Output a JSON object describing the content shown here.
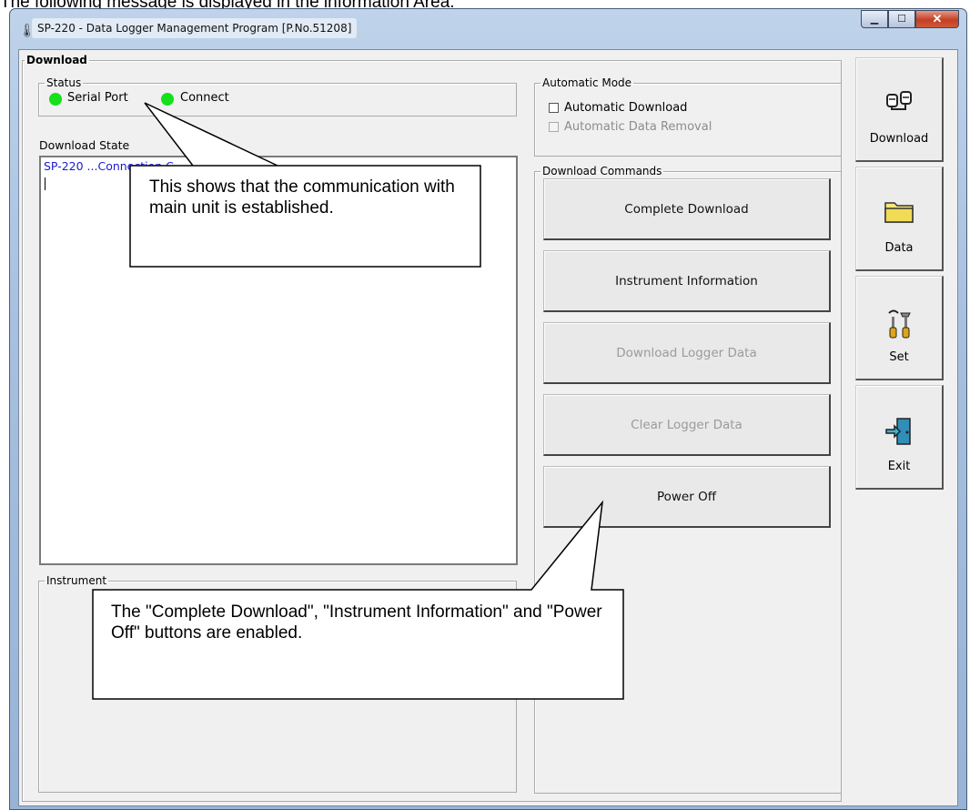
{
  "caption": "The following message is displayed in the information Area.",
  "window": {
    "title": "SP-220  - Data Logger Management Program [P.No.51208]"
  },
  "download_panel": {
    "title": "Download",
    "status": {
      "title": "Status",
      "serial_port": "Serial Port",
      "connect": "Connect",
      "led_color": "#15e01a"
    },
    "download_state_label": "Download State",
    "log_text": "SP-220 ...Connection C",
    "instrument_title": "Instrument"
  },
  "automatic_mode": {
    "title": "Automatic Mode",
    "automatic_download": "Automatic Download",
    "automatic_data_removal": "Automatic Data Removal"
  },
  "download_commands": {
    "title": "Download Commands",
    "complete_download": "Complete Download",
    "instrument_information": "Instrument Information",
    "download_logger_data": "Download Logger Data",
    "clear_logger_data": "Clear Logger Data",
    "power_off": "Power Off"
  },
  "sidebar": {
    "download": "Download",
    "data": "Data",
    "set": "Set",
    "exit": "Exit"
  },
  "callouts": {
    "connection": "This shows that the communication with main unit is established.",
    "buttons": "The \"Complete Download\", \"Instrument Information\" and \"Power Off\" buttons are enabled."
  }
}
